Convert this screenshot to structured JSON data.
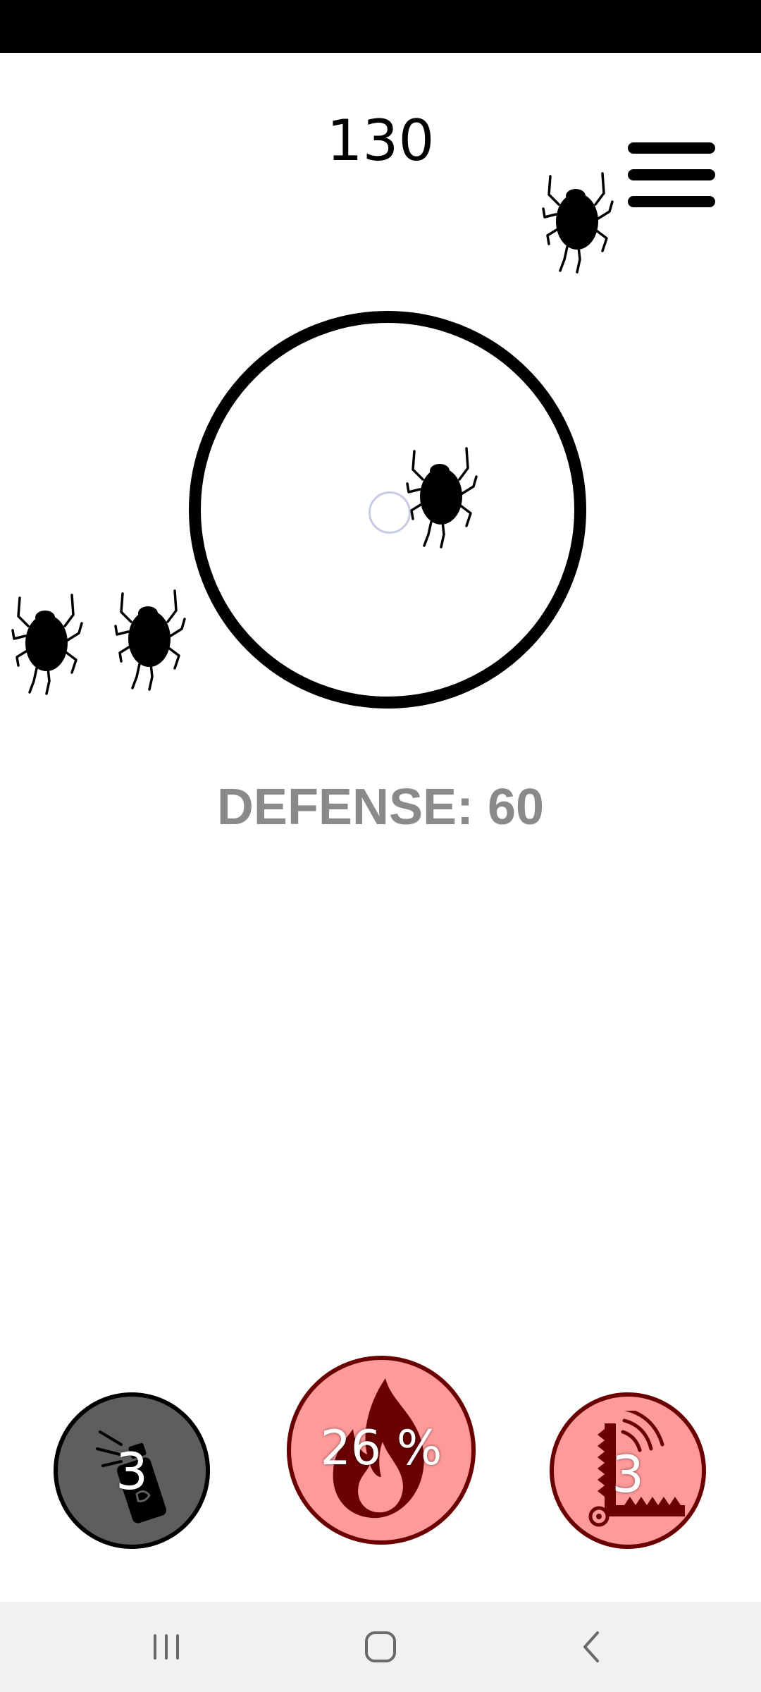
{
  "game": {
    "score": "130",
    "defense_text": "DEFENSE: 60"
  },
  "powerups": {
    "spray": {
      "count": "3",
      "icon": "spray-can-icon",
      "color": "#5e5e5e"
    },
    "fire": {
      "count": "26 %",
      "icon": "fire-icon",
      "color": "#ff9a9a"
    },
    "trap": {
      "count": "3",
      "icon": "trap-icon",
      "color": "#ff9a9a"
    }
  },
  "colors": {
    "defense_text": "#8a8a8a",
    "powerup_border_dark": "#6b0000"
  },
  "navigation": {
    "recent": "recent-apps-icon",
    "home": "home-icon",
    "back": "back-icon"
  }
}
